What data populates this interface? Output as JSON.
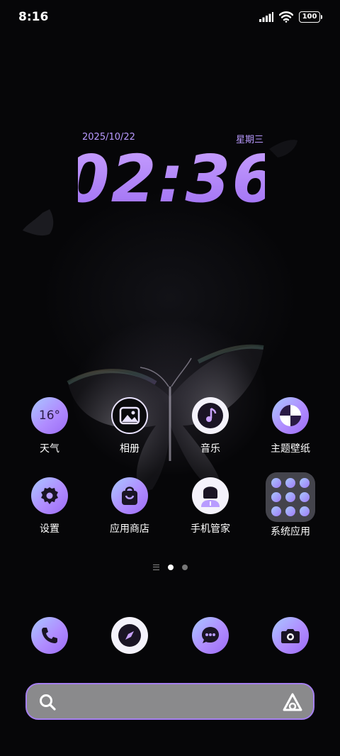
{
  "status_bar": {
    "time": "8:16",
    "battery": "100"
  },
  "clock_widget": {
    "date": "2025/10/22",
    "weekday": "星期三",
    "time": "02:36"
  },
  "apps": [
    {
      "label": "天气",
      "icon": "weather-icon",
      "text": "16°"
    },
    {
      "label": "相册",
      "icon": "gallery-icon"
    },
    {
      "label": "音乐",
      "icon": "music-icon"
    },
    {
      "label": "主题壁纸",
      "icon": "themes-icon"
    },
    {
      "label": "设置",
      "icon": "settings-icon"
    },
    {
      "label": "应用商店",
      "icon": "app-store-icon"
    },
    {
      "label": "手机管家",
      "icon": "phone-manager-icon"
    },
    {
      "label": "系统应用",
      "icon": "folder-icon"
    }
  ],
  "dock": [
    {
      "icon": "phone-icon"
    },
    {
      "icon": "browser-compass-icon"
    },
    {
      "icon": "messages-icon"
    },
    {
      "icon": "camera-icon"
    }
  ],
  "page_indicator": {
    "current_page": 1,
    "total_pages": 2
  },
  "colors": {
    "accent": "#b084f7",
    "accent_light": "#a8c8ff",
    "search_border": "#a680f0"
  }
}
